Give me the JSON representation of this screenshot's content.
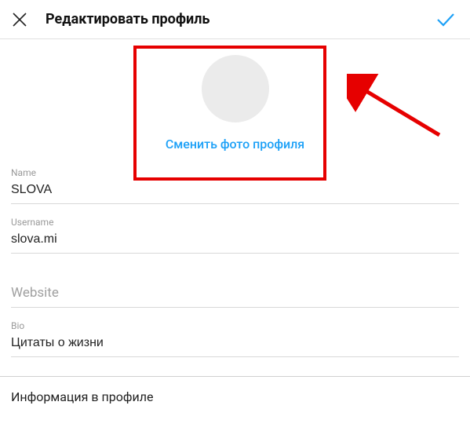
{
  "header": {
    "title": "Редактировать профиль"
  },
  "photo": {
    "change_label": "Сменить фото профиля"
  },
  "fields": {
    "name": {
      "label": "Name",
      "value": "SLOVA"
    },
    "username": {
      "label": "Username",
      "value": "slova.mi"
    },
    "website": {
      "placeholder": "Website",
      "value": ""
    },
    "bio": {
      "label": "Bio",
      "value": "Цитаты о жизни"
    }
  },
  "profile_info": {
    "label": "Информация в профиле"
  },
  "colors": {
    "accent": "#1ea1f7",
    "highlight": "#e60000"
  }
}
